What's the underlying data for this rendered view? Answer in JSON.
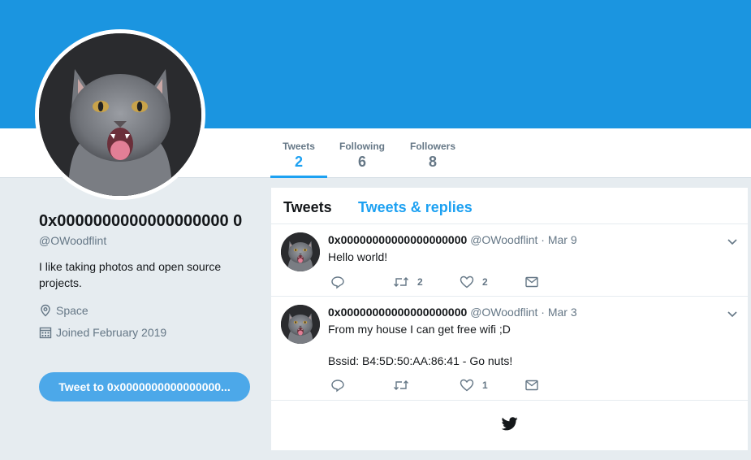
{
  "nav": {
    "stats": [
      {
        "label": "Tweets",
        "value": "2",
        "active": true
      },
      {
        "label": "Following",
        "value": "6"
      },
      {
        "label": "Followers",
        "value": "8"
      }
    ]
  },
  "profile": {
    "name": "0x0000000000000000000 0",
    "handle": "@OWoodflint",
    "bio": "I like taking photos and open source projects.",
    "location": "Space",
    "joined": "Joined February 2019",
    "tweet_to_label": "Tweet to 0x0000000000000000..."
  },
  "timeline": {
    "tabs": [
      "Tweets",
      "Tweets & replies"
    ],
    "tweets": [
      {
        "username": "0x00000000000000000000",
        "handle": "@OWoodflint",
        "date": "Mar 9",
        "lines": [
          "Hello world!"
        ],
        "retweets": "2",
        "likes": "2"
      },
      {
        "username": "0x00000000000000000000",
        "handle": "@OWoodflint",
        "date": "Mar 3",
        "lines": [
          "From my house I can get free wifi ;D",
          "",
          "Bssid: B4:5D:50:AA:86:41 - Go nuts!"
        ],
        "retweets": "",
        "likes": "1"
      }
    ]
  },
  "colors": {
    "banner": "#1b95e0",
    "accent": "#1da1f2",
    "tweet_to_button": "#4ca8e9"
  },
  "icons": [
    "reply-icon",
    "retweet-icon",
    "like-icon",
    "dm-icon",
    "chevron-down-icon",
    "location-icon",
    "calendar-icon",
    "twitter-bird-icon"
  ]
}
